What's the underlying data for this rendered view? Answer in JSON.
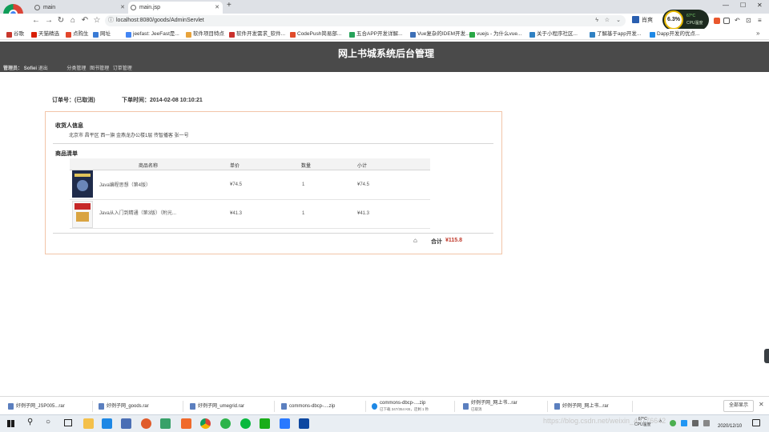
{
  "browser": {
    "tabs": [
      {
        "label": "main",
        "active": false
      },
      {
        "label": "main.jsp",
        "active": true
      }
    ],
    "new_tab_glyph": "+",
    "address": "localhost:8080/goods/AdminServlet",
    "bookmarks": [
      {
        "label": "谷歌",
        "color": "#c8372d"
      },
      {
        "label": "天猫精选",
        "color": "#d81e06"
      },
      {
        "label": "点购生",
        "color": "#e2462c"
      },
      {
        "label": "网址",
        "color": "#3a7bd5"
      },
      {
        "label": "jeefast: JeeFast是...",
        "color": "#4285f4"
      },
      {
        "label": "软件项目特点",
        "color": "#e8a33b"
      },
      {
        "label": "软件开发需求_软件...",
        "color": "#c9302c"
      },
      {
        "label": "CodePush简易部...",
        "color": "#e04b2a"
      },
      {
        "label": "五合APP开发详解...",
        "color": "#27a35a"
      },
      {
        "label": "Vue复杂的IDEM开发...",
        "color": "#3d6fb6"
      },
      {
        "label": "vuejs - 为什么vue...",
        "color": "#28a745"
      },
      {
        "label": "关于小程序社区...",
        "color": "#2f80c2"
      },
      {
        "label": "了解基于app开发...",
        "color": "#2f80c2"
      },
      {
        "label": "Dapp开发的优点...",
        "color": "#1e88e5"
      }
    ],
    "temperature": "67°C",
    "cpu_label": "CPU温度",
    "perf_value": "6.3%",
    "user_label": "肖爽"
  },
  "site": {
    "title": "网上书城系统后台管理",
    "admin_label": "管理员：",
    "admin_name": "Sofiei",
    "logout": "退出",
    "nav_links": [
      "分类管理",
      "图书管理",
      "订单管理"
    ]
  },
  "order": {
    "number_label": "订单号：",
    "number_value": "(已取消)",
    "time_label": "下单时间：",
    "time_value": "2014-02-08 10:10:21",
    "receiver_title": "收货人信息",
    "receiver_info": "北京市 昌平区 西一旗 金燕龙办公楼1层 传智播客 张一号",
    "items_title": "商品清单",
    "columns": [
      "商品名称",
      "单价",
      "数量",
      "小计"
    ],
    "items": [
      {
        "name": "Java编程思想（第4版）",
        "price": "¥74.5",
        "qty": "1",
        "subtotal": "¥74.5",
        "cover_color": "#1f2b4a"
      },
      {
        "name": "Java从入门到精通（第3版）（附光...",
        "price": "¥41.3",
        "qty": "1",
        "subtotal": "¥41.3",
        "cover_color": "#c62828"
      }
    ],
    "total_label": "合计",
    "total_value": "¥115.8",
    "home_glyph": "⌂"
  },
  "downloads": [
    "好例子网_JSP005...rar",
    "好例子网_goods.rar",
    "好例子网_umegrid.rar",
    "commons-dbcp-....zip",
    "commons-dbcp-....zip",
    "好例子网_网上书...rar",
    "好例子网_网上书...rar"
  ],
  "download_progress_note": "已下载 347/354 KB，还剩 1 秒",
  "download_status_note": "已取消",
  "show_all_label": "全部显示",
  "taskbar": {
    "clock_time": "",
    "clock_date": "2020/12/10",
    "watermark": "https://blog.csdn.net/weixin_45776642",
    "weather_temp": "67°C",
    "weather_label": "CPU温度"
  }
}
